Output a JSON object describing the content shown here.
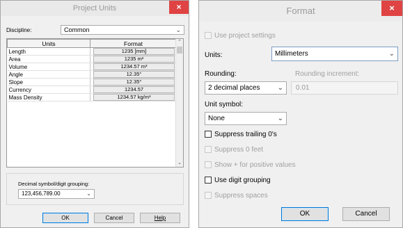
{
  "left_dialog": {
    "title": "Project Units",
    "close_glyph": "×",
    "discipline_label": "Discipline:",
    "discipline_value": "Common",
    "table_headers": [
      "Units",
      "Format"
    ],
    "rows": [
      {
        "unit": "Length",
        "format": "1235 [mm]"
      },
      {
        "unit": "Area",
        "format": "1235 m²"
      },
      {
        "unit": "Volume",
        "format": "1234.57 m³"
      },
      {
        "unit": "Angle",
        "format": "12.35°"
      },
      {
        "unit": "Slope",
        "format": "12.35°"
      },
      {
        "unit": "Currency",
        "format": "1234.57"
      },
      {
        "unit": "Mass Density",
        "format": "1234.57 kg/m³"
      }
    ],
    "decimal_label": "Decimal symbol/digit grouping:",
    "decimal_value": "123,456,789.00",
    "ok_label": "OK",
    "cancel_label": "Cancel",
    "help_label": "Help"
  },
  "right_dialog": {
    "title": "Format",
    "close_glyph": "×",
    "use_project_settings": "Use project settings",
    "units_label": "Units:",
    "units_value": "Millimeters",
    "rounding_label": "Rounding:",
    "rounding_value": "2 decimal places",
    "rounding_increment_label": "Rounding increment:",
    "rounding_increment_value": "0.01",
    "unit_symbol_label": "Unit symbol:",
    "unit_symbol_value": "None",
    "suppress_trailing": "Suppress trailing 0's",
    "suppress_feet": "Suppress 0 feet",
    "show_plus": "Show + for positive values",
    "use_digit_grouping": "Use digit grouping",
    "suppress_spaces": "Suppress spaces",
    "ok_label": "OK",
    "cancel_label": "Cancel"
  }
}
